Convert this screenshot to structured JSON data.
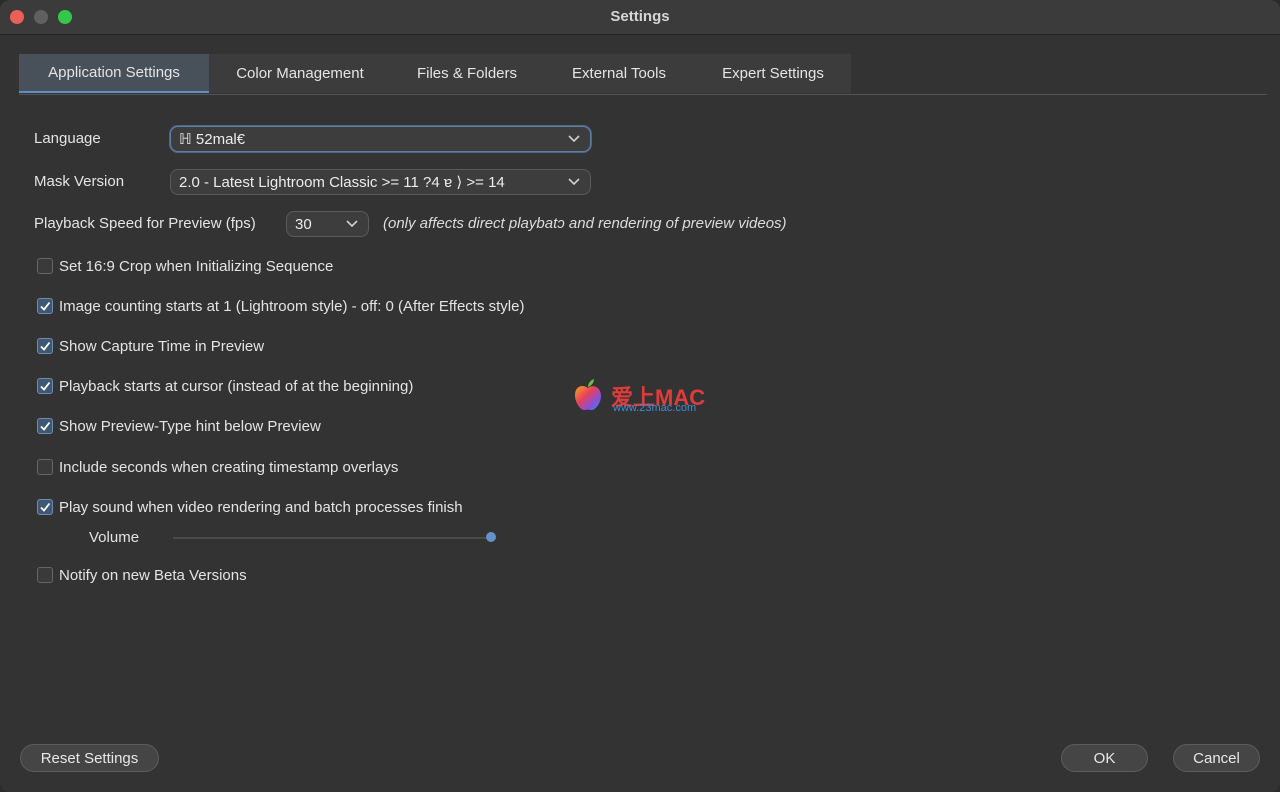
{
  "window": {
    "title": "Settings",
    "colors": {
      "accent": "#5d8fc6",
      "background": "#333333",
      "close": "#ec5f57",
      "maximize": "#34c749"
    }
  },
  "tabs": [
    {
      "label": "Application Settings",
      "active": true
    },
    {
      "label": "Color Management"
    },
    {
      "label": "Files & Folders"
    },
    {
      "label": "External Tools"
    },
    {
      "label": "Expert Settings"
    }
  ],
  "settings": {
    "language": {
      "label": "Language",
      "value": "ℍ 52mal€"
    },
    "mask_version": {
      "label": "Mask Version",
      "value": "2.0 - Latest Lightroom Classic >= 11 ?4 ɐ ⟩ >= 14"
    },
    "playback_speed": {
      "label": "Playback Speed for Preview (fps)",
      "value": "30",
      "hint": "(only affects direct playbatɔ and rendering of preview videos)"
    },
    "checkboxes": [
      {
        "label": "Set 16:9 Crop when Initializing Sequence",
        "checked": false
      },
      {
        "label": "Image counting starts at 1 (Lightroom style) - off: 0 (After Effects style)",
        "checked": true
      },
      {
        "label": "Show Capture Time in Preview",
        "checked": true
      },
      {
        "label": "Playback starts at cursor (instead of at the beginning)",
        "checked": true
      },
      {
        "label": "Show Preview-Type hint below Preview",
        "checked": true
      },
      {
        "label": "Include seconds when creating timestamp overlays",
        "checked": false
      },
      {
        "label": "Play sound when video rendering and batch processes finish",
        "checked": true
      },
      {
        "label": "Notify on new Beta Versions",
        "checked": false
      }
    ],
    "volume": {
      "label": "Volume",
      "level": 1.0
    }
  },
  "watermark": {
    "title": "爱上MAC",
    "url": "www.23mac.com",
    "icon": "apple-logo-icon"
  },
  "footer": {
    "reset_label": "Reset Settings",
    "ok_label": "OK",
    "cancel_label": "Cancel"
  }
}
